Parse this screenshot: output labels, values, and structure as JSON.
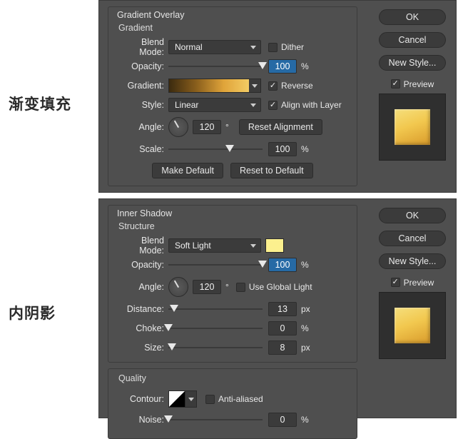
{
  "labels": {
    "top_cn": "渐变填充",
    "bottom_cn": "内阴影"
  },
  "gradient_overlay": {
    "title": "Gradient Overlay",
    "group": "Gradient",
    "blend_mode_label": "Blend Mode:",
    "blend_mode": "Normal",
    "dither_label": "Dither",
    "dither_checked": false,
    "opacity_label": "Opacity:",
    "opacity": "100",
    "opacity_unit": "%",
    "gradient_label": "Gradient:",
    "reverse_label": "Reverse",
    "reverse_checked": true,
    "style_label": "Style:",
    "style": "Linear",
    "align_label": "Align with Layer",
    "align_checked": true,
    "angle_label": "Angle:",
    "angle_value": "120",
    "angle_unit": "°",
    "reset_align_btn": "Reset Alignment",
    "scale_label": "Scale:",
    "scale_value": "100",
    "scale_unit": "%",
    "make_default_btn": "Make Default",
    "reset_default_btn": "Reset to Default"
  },
  "inner_shadow": {
    "title": "Inner Shadow",
    "group": "Structure",
    "blend_mode_label": "Blend Mode:",
    "blend_mode": "Soft Light",
    "color": "#fcf08e",
    "opacity_label": "Opacity:",
    "opacity": "100",
    "opacity_unit": "%",
    "angle_label": "Angle:",
    "angle_value": "120",
    "angle_unit": "°",
    "globallight_label": "Use Global Light",
    "globallight_checked": false,
    "distance_label": "Distance:",
    "distance_value": "13",
    "distance_unit": "px",
    "choke_label": "Choke:",
    "choke_value": "0",
    "choke_unit": "%",
    "size_label": "Size:",
    "size_value": "8",
    "size_unit": "px",
    "quality_group": "Quality",
    "contour_label": "Contour:",
    "antialias_label": "Anti-aliased",
    "antialias_checked": false,
    "noise_label": "Noise:",
    "noise_value": "0",
    "noise_unit": "%"
  },
  "side": {
    "ok": "OK",
    "cancel": "Cancel",
    "new_style": "New Style...",
    "preview_label": "Preview",
    "preview_checked": true
  }
}
